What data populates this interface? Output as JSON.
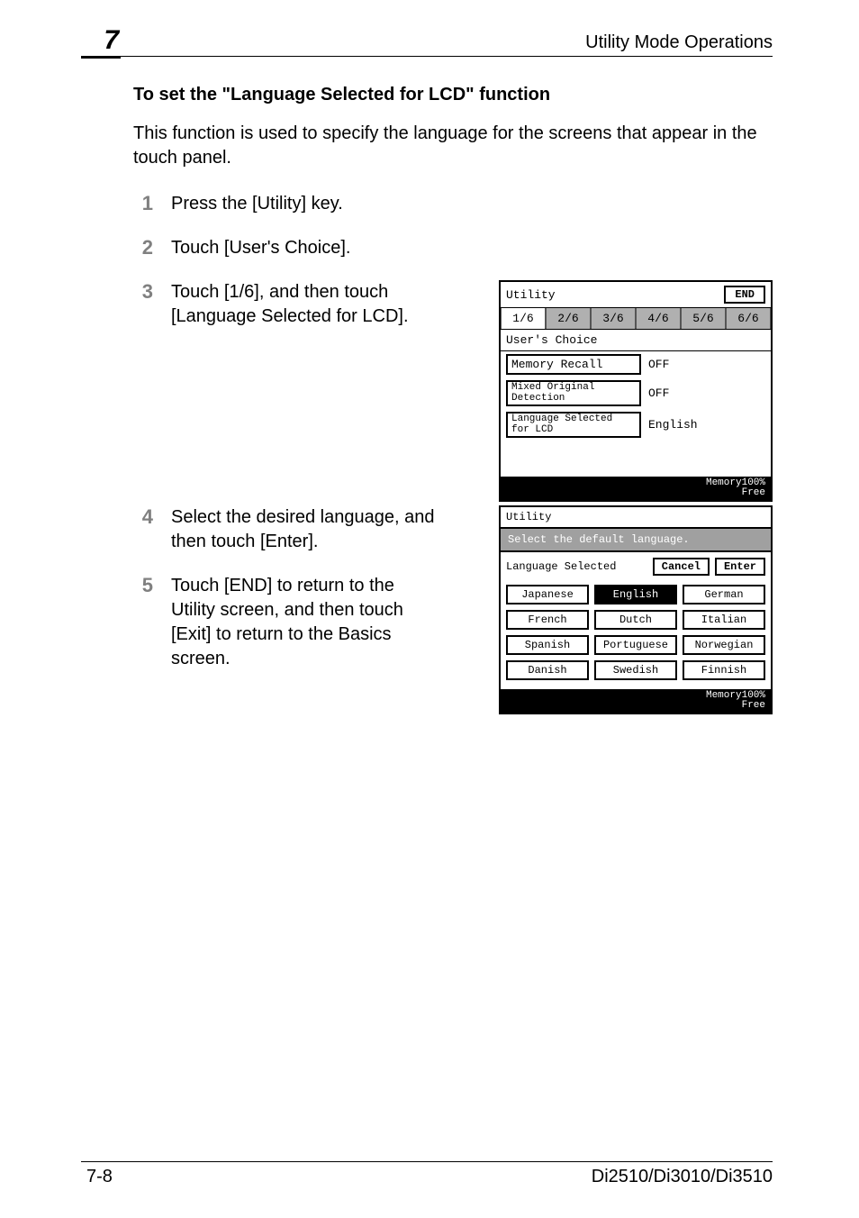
{
  "header": {
    "chapter": "7",
    "title": "Utility Mode Operations"
  },
  "section": {
    "heading": "To set the \"Language Selected for LCD\" function",
    "intro": "This function is used to specify the language for the screens that appear in the touch panel."
  },
  "steps": {
    "s1": {
      "num": "1",
      "text": "Press the [Utility] key."
    },
    "s2": {
      "num": "2",
      "text": "Touch [User's Choice]."
    },
    "s3": {
      "num": "3",
      "text": "Touch [1/6], and then touch [Language Selected for LCD]."
    },
    "s4": {
      "num": "4",
      "text": "Select the desired language, and then touch [Enter]."
    },
    "s5": {
      "num": "5",
      "text": "Touch [END] to return to the Utility screen, and then touch [Exit] to return to the Basics screen."
    }
  },
  "panelA": {
    "title": "Utility",
    "end": "END",
    "tabs": [
      "1/6",
      "2/6",
      "3/6",
      "4/6",
      "5/6",
      "6/6"
    ],
    "subhead": "User's Choice",
    "rows": [
      {
        "label": "Memory Recall",
        "value": "OFF"
      },
      {
        "label_l1": "Mixed Original",
        "label_l2": "Detection",
        "value": "OFF"
      },
      {
        "label_l1": "Language Selected",
        "label_l2": "for LCD",
        "value": "English"
      }
    ],
    "footer_l1": "Memory",
    "footer_v": "100%",
    "footer_l2": "Free"
  },
  "panelB": {
    "title": "Utility",
    "banner": "Select the default language.",
    "sel_label": "Language Selected",
    "cancel": "Cancel",
    "enter": "Enter",
    "langs": [
      [
        "Japanese",
        "English",
        "German"
      ],
      [
        "French",
        "Dutch",
        "Italian"
      ],
      [
        "Spanish",
        "Portuguese",
        "Norwegian"
      ],
      [
        "Danish",
        "Swedish",
        "Finnish"
      ]
    ],
    "selected": "English",
    "footer_l1": "Memory",
    "footer_v": "100%",
    "footer_l2": "Free"
  },
  "footer": {
    "page": "7-8",
    "model": "Di2510/Di3010/Di3510"
  }
}
